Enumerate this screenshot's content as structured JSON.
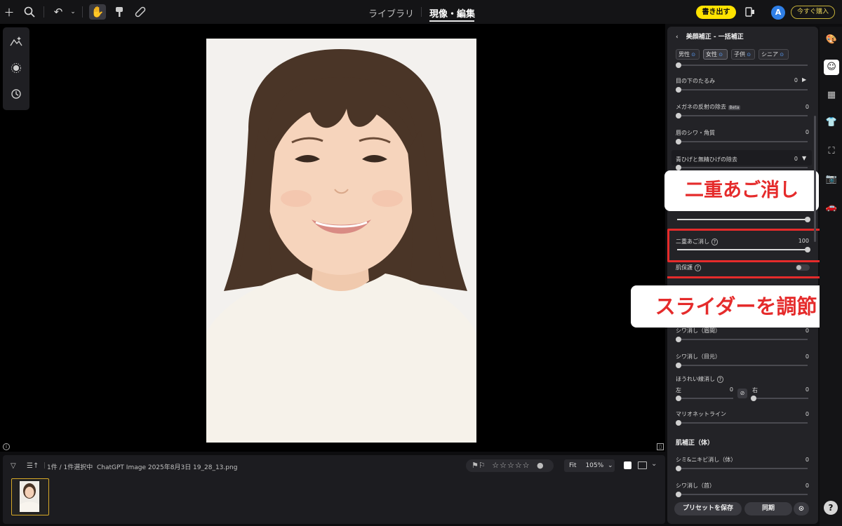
{
  "topbar": {
    "tabs": [
      {
        "label": "ライブラリ"
      },
      {
        "label": "現像・編集"
      }
    ],
    "export_label": "書き出す",
    "avatar_initial": "A",
    "buy_label": "今すぐ購入"
  },
  "filmstrip": {
    "count_label": "1件 / 1件選択中",
    "filename": "ChatGPT Image 2025年8月3日 19_28_13.png",
    "stars": "☆☆☆☆☆",
    "fit_label": "Fit",
    "zoom": "105%"
  },
  "panel": {
    "title": "美顔補正 - 一括補正",
    "chips": [
      "男性",
      "女性",
      "子供",
      "シニア"
    ],
    "sliders": {
      "tarumi": {
        "label": "目の下のたるみ",
        "value": "0"
      },
      "glasses": {
        "label": "メガネの反射の除去",
        "badge": "Beta",
        "value": "0"
      },
      "lip": {
        "label": "唇のシワ・角質",
        "value": "0"
      },
      "beard": {
        "label": "青ひげと無精ひげの除去",
        "value": "0"
      },
      "double_chin": {
        "label": "二重あご消し",
        "value": "100"
      },
      "skin_protect": {
        "label": "肌保護"
      },
      "brow_wrinkle": {
        "label": "シワ消し（眉間）",
        "value": "0"
      },
      "eye_wrinkle": {
        "label": "シワ消し（目元）",
        "value": "0"
      },
      "nasolabial": {
        "label": "ほうれい線消し",
        "left_label": "左",
        "left_value": "0",
        "right_label": "右",
        "right_value": "0"
      },
      "marionette": {
        "label": "マリオネットライン",
        "value": "0"
      },
      "body_section": "肌補正（体）",
      "body_spot": {
        "label": "シミ&ニキビ消し（体）",
        "value": "0"
      },
      "neck_wrinkle": {
        "label": "シワ消し（首）",
        "value": "0"
      }
    },
    "save_preset": "プリセットを保存",
    "sync": "同期"
  },
  "overlay": {
    "callout_top": "二重あご消し",
    "callout_bottom": "スライダーを調節"
  },
  "help_label": "?"
}
